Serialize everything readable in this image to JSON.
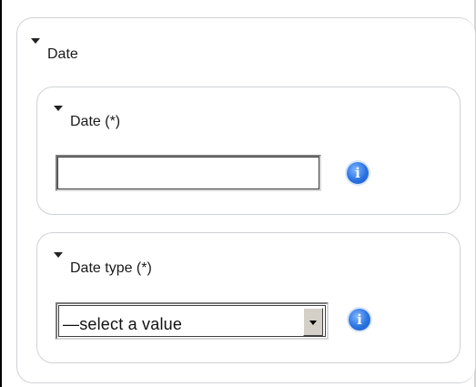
{
  "outer_section": {
    "title": "Date"
  },
  "date_field": {
    "label": "Date (*)",
    "value": "",
    "info_icon": "info-icon"
  },
  "date_type_field": {
    "label": "Date type (*)",
    "selected": "—select a value",
    "info_icon": "info-icon"
  },
  "colors": {
    "border": "#cfd2d6",
    "info_blue": "#2a73e0",
    "text": "#1a1a1a"
  }
}
